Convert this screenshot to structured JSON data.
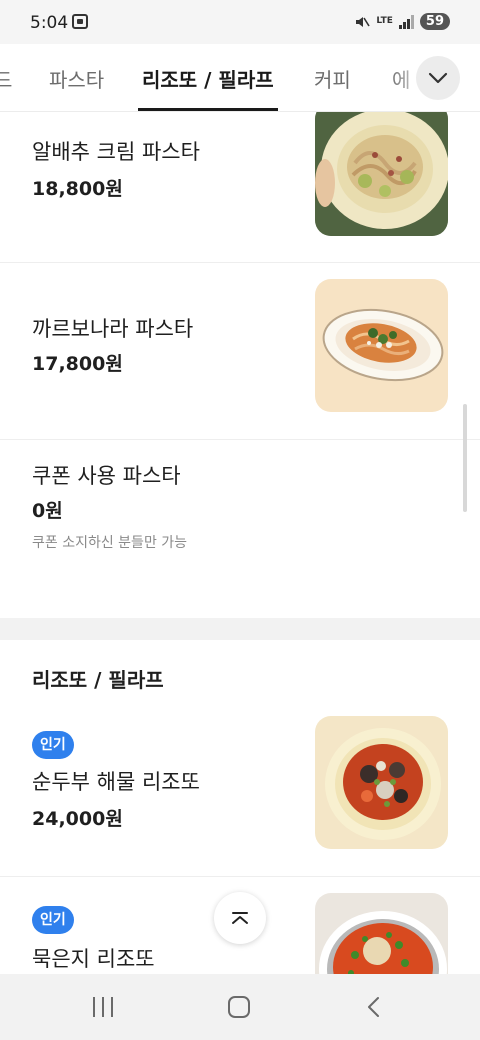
{
  "status_bar": {
    "time": "5:04",
    "network": "LTE",
    "battery": "59"
  },
  "tabs": [
    {
      "label": "드"
    },
    {
      "label": "파스타"
    },
    {
      "label": "리조또 / 필라프",
      "active": true
    },
    {
      "label": "커피"
    },
    {
      "label": "에"
    }
  ],
  "menu_items": [
    {
      "name": "알배추 크림 파스타",
      "price": "18,800원"
    },
    {
      "name": "까르보나라 파스타",
      "price": "17,800원"
    },
    {
      "name": "쿠폰 사용 파스타",
      "price": "0원",
      "description": "쿠폰 소지하신 분들만 가능"
    }
  ],
  "section": {
    "title": "리조또 / 필라프",
    "items": [
      {
        "badge": "인기",
        "name": "순두부 해물 리조또",
        "price": "24,000원"
      },
      {
        "badge": "인기",
        "name": "묵은지 리조또"
      }
    ]
  },
  "icons": {
    "tab_more": "chevron-down-icon",
    "scroll_top": "chevron-up-icon",
    "nav_recents": "recents-icon",
    "nav_home": "home-icon",
    "nav_back": "back-icon"
  },
  "colors": {
    "badge": "#2f80ed",
    "active_tab": "#1a1a1a",
    "section_gap": "#f2f2f2"
  }
}
